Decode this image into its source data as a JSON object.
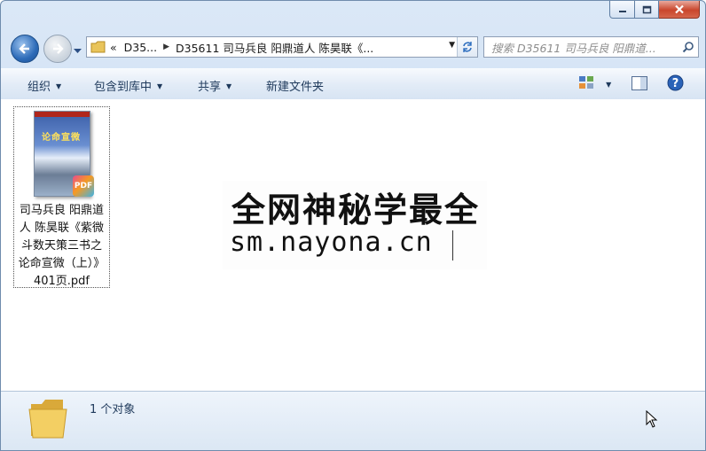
{
  "address": {
    "crumb_overflow": "«",
    "crumb1": "D35...",
    "crumb2": "D35611 司马兵良 阳鼎道人 陈昊联《..."
  },
  "search": {
    "placeholder": "搜索 D35611 司马兵良 阳鼎道..."
  },
  "toolbar": {
    "organize": "组织",
    "include_library": "包含到库中",
    "share": "共享",
    "new_folder": "新建文件夹"
  },
  "file": {
    "name": "司马兵良 阳鼎道人 陈昊联《紫微斗数天策三书之论命宣微（上）》401页.pdf",
    "badge": "PDF",
    "cover_title": "论命宣微"
  },
  "watermark": {
    "line1": "全网神秘学最全",
    "line2": "sm.nayona.cn"
  },
  "status": {
    "count": "1 个对象"
  },
  "icons": [
    "minimize-icon",
    "maximize-icon",
    "close-icon",
    "back-arrow-icon",
    "forward-arrow-icon",
    "folder-icon",
    "refresh-icon",
    "search-icon",
    "view-options-icon",
    "preview-pane-icon",
    "help-icon",
    "pdf-icon",
    "mouse-cursor-icon"
  ]
}
